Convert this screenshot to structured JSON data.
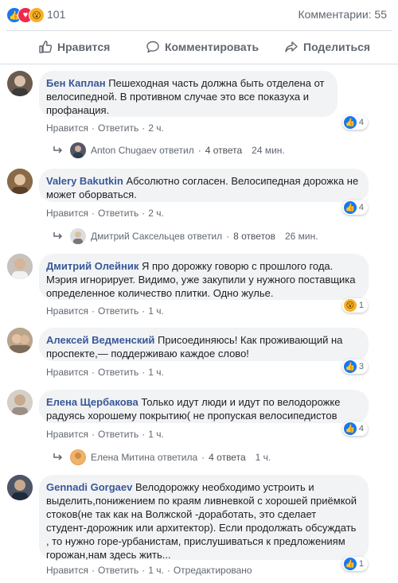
{
  "summary": {
    "reaction_count": "101",
    "comments_label": "Комментарии: 55"
  },
  "actions": {
    "like": "Нравится",
    "comment": "Комментировать",
    "share": "Поделиться"
  },
  "comment_meta_labels": {
    "like": "Нравится",
    "reply": "Ответить",
    "edited": "Отредактировано"
  },
  "comments": [
    {
      "author": "Бен Каплан",
      "text": "Пешеходная часть должна быть отделена от велосипедной. В противном случае это все показуха и профанация.",
      "time": "2 ч.",
      "reaction": "like",
      "reaction_count": "4",
      "reply": {
        "name": "Anton Chugaev",
        "verb": "ответил",
        "count": "4 ответа",
        "time": "24 мин."
      }
    },
    {
      "author": "Valery Bakutkin",
      "text": "Абсолютно согласен. Велосипедная дорожка не может оборваться.",
      "time": "2 ч.",
      "reaction": "like",
      "reaction_count": "4",
      "reply": {
        "name": "Дмитрий Саксельцев",
        "verb": "ответил",
        "count": "8 ответов",
        "time": "26 мин."
      }
    },
    {
      "author": "Дмитрий Олейник",
      "text": "Я про дорожку говорю с прошлого года. Мэрия игнорирует. Видимо, уже закупили у нужного поставщика определенное количество плитки. Одно жулье.",
      "time": "1 ч.",
      "reaction": "wow",
      "reaction_count": "1"
    },
    {
      "author": "Алексей Ведменский",
      "text": "Присоединяюсь! Как проживающий на проспекте,— поддерживаю каждое слово!",
      "time": "1 ч.",
      "reaction": "like",
      "reaction_count": "3"
    },
    {
      "author": "Елена Щербакова",
      "text": "Только идут люди и идут по велодорожке радуясь хорошему покрытию( не пропуская велосипедистов",
      "time": "1 ч.",
      "reaction": "like",
      "reaction_count": "4",
      "reply": {
        "name": "Елена Митина",
        "verb": "ответила",
        "count": "4 ответа",
        "time": "1 ч."
      }
    },
    {
      "author": "Gennadi Gorgaev",
      "text": "Велодорожку необходимо устроить и выделить,понижением по краям ливневкой с хорошей приёмкой стоков(не так как на Волжской -доработать, это сделает студент-дорожник или архитектор). Если продолжать обсуждать , то нужно горе-урбанистам, прислушиваться к предложениям горожан,нам здесь жить...",
      "time": "1 ч.",
      "reaction": "like",
      "reaction_count": "1"
    }
  ],
  "colors": {
    "link": "#385898",
    "muted": "#606770",
    "bubble": "#f2f3f5",
    "like": "#1877f2"
  }
}
